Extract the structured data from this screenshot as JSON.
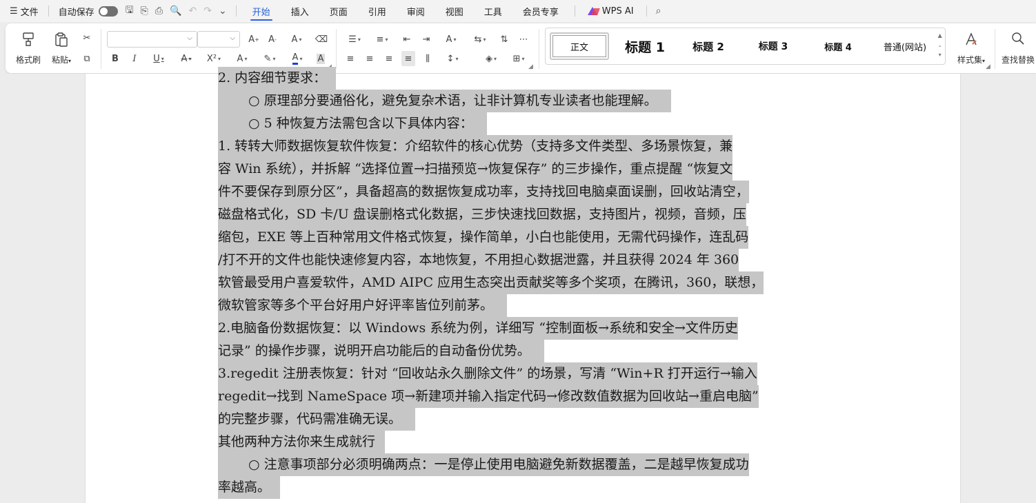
{
  "menubar": {
    "file": "文件",
    "autosave": "自动保存",
    "tabs": [
      "开始",
      "插入",
      "页面",
      "引用",
      "审阅",
      "视图",
      "工具",
      "会员专享"
    ],
    "active_tab": "开始",
    "wps_ai": "WPS AI"
  },
  "ribbon": {
    "format_painter": "格式刷",
    "paste": "粘贴",
    "font_name": "",
    "font_size": "",
    "styles": [
      "正文",
      "标题 1",
      "标题 2",
      "标题 3",
      "标题 4",
      "普通(网站)"
    ],
    "style_set": "样式集",
    "find_replace": "查找替换"
  },
  "document": {
    "lines": [
      "2.  内容细节要求：",
      "○  原理部分要通俗化，避免复杂术语，让非计算机专业读者也能理解。",
      "○ 5  种恢复方法需包含以下具体内容：",
      "1. 转转大师数据恢复软件恢复：介绍软件的核心优势（支持多文件类型、多场景恢复，兼",
      "容 Win 系统），并拆解 “选择位置→扫描预览→恢复保存” 的三步操作，重点提醒 “恢复文",
      "件不要保存到原分区”，具备超高的数据恢复成功率，支持找回电脑桌面误删，回收站清空，",
      "磁盘格式化，SD 卡/U 盘误删格式化数据，三步快速找回数据，支持图片，视频，音频，压",
      "缩包，EXE 等上百种常用文件格式恢复，操作简单，小白也能使用，无需代码操作，连乱码",
      "/打不开的文件也能快速修复内容，本地恢复，不用担心数据泄露，并且获得 2024 年 360",
      "软管最受用户喜爱软件，AMD AIPC 应用生态突出贡献奖等多个奖项，在腾讯，360，联想，",
      "微软管家等多个平台好用户好评率皆位列前茅。",
      "2.电脑备份数据恢复：以 Windows 系统为例，详细写 “控制面板→系统和安全→文件历史",
      "记录” 的操作步骤，说明开启功能后的自动备份优势。",
      "3.regedit 注册表恢复：针对 “回收站永久删除文件” 的场景，写清 “Win+R 打开运行→输入",
      "regedit→找到 NameSpace 项→新建项并输入指定代码→修改数值数据为回收站→重启电脑”",
      "的完整步骤，代码需准确无误。",
      "其他两种方法你来生成就行",
      "○  注意事项部分必须明确两点：一是停止使用电脑避免新数据覆盖，二是越早恢复成功",
      "率越高。"
    ]
  }
}
